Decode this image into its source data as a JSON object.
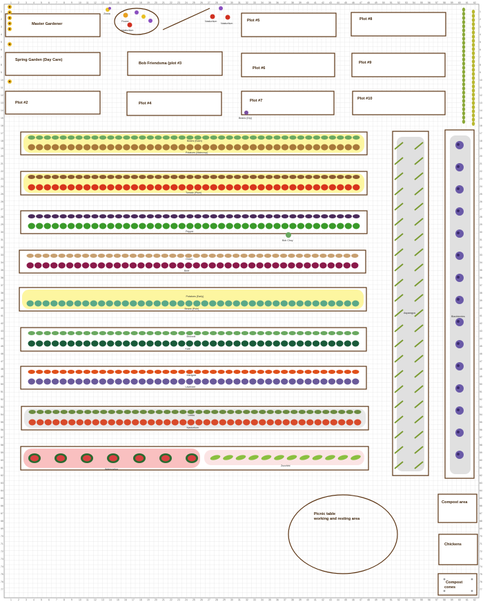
{
  "plots": [
    {
      "id": "master",
      "label": "Master  Gardener"
    },
    {
      "id": "spring",
      "label": "Spring Garden (Day Care)"
    },
    {
      "id": "plot2",
      "label": "Plot #2"
    },
    {
      "id": "bob",
      "label": "Bob Friendsma (plot #3"
    },
    {
      "id": "plot4",
      "label": "Plot #4"
    },
    {
      "id": "plot5",
      "label": "Plot #5"
    },
    {
      "id": "plot6",
      "label": "Plot #6"
    },
    {
      "id": "plot7",
      "label": "Plot #7"
    },
    {
      "id": "plot8",
      "label": "Plot #8"
    },
    {
      "id": "plot9",
      "label": "Plot #9"
    },
    {
      "id": "plot10",
      "label": "Plot #10"
    }
  ],
  "beds": [
    {
      "id": "bed1",
      "top": "Beans (Bush)",
      "bottom": "Potatoes (Maincrop)",
      "fill": "#fdf6a0",
      "topPlant": "bean",
      "botPlant": "potato"
    },
    {
      "id": "bed2",
      "top": "",
      "bottom": "Tomato (Plum)",
      "fill": "#fdf6a0",
      "topPlant": "trellis",
      "botPlant": "tomato"
    },
    {
      "id": "bed3",
      "top": "",
      "bottom": "Pepper",
      "fill": "#ffffff",
      "topPlant": "eggplant",
      "botPlant": "pepper"
    },
    {
      "id": "bed4",
      "top": "Onion",
      "bottom": "Beet",
      "fill": "#ffffff",
      "topPlant": "onion",
      "botPlant": "beet"
    },
    {
      "id": "bed5",
      "top": "Potatoes (Early)",
      "bottom": "Beans (Pole)",
      "fill": "#fdf6a0",
      "topPlant": "none",
      "botPlant": "polebean"
    },
    {
      "id": "bed6",
      "top": "Broccoli",
      "bottom": "Kale",
      "fill": "#ffffff",
      "topPlant": "bean",
      "botPlant": "kale"
    },
    {
      "id": "bed7",
      "top": "Marigold",
      "bottom": "Lavender",
      "fill": "#ffffff",
      "topPlant": "marigold",
      "botPlant": "lavender"
    },
    {
      "id": "bed8",
      "top": "Leeks",
      "bottom": "Nasturtium",
      "fill": "#e8e8e8",
      "topPlant": "leek",
      "botPlant": "nasturtium"
    }
  ],
  "melon_bed": {
    "left": "Watermelon",
    "right": "Zucchini"
  },
  "asparagus": {
    "label": "Asparagus"
  },
  "blackberries": {
    "label": "Blackberries"
  },
  "bok_choy": {
    "label": "Bok Choy"
  },
  "beans_dry": {
    "label": "Beans (Dry)"
  },
  "top_tiny": {
    "zinnia": "Zinnia",
    "nasturtium1": "Nasturtium",
    "nasturtium2": "Nasturtium",
    "nasturtium3": "Nasturtium",
    "flower": "Flower"
  },
  "picnic": {
    "line1": "Picnic table",
    "line2": "working and resting area"
  },
  "compost1": {
    "label": "Compost area"
  },
  "chickens": {
    "label": "Chickens"
  },
  "compost2": {
    "line1": "Compost",
    "line2": "cones"
  },
  "colors": {
    "border": "#5a3210",
    "yellow_fill": "#fdf6a0",
    "melon_fill": "#f9c0c0",
    "gray_fill": "#dcdcdc",
    "grid": "#d8d8d8",
    "grid_major": "#b8b8b8"
  }
}
